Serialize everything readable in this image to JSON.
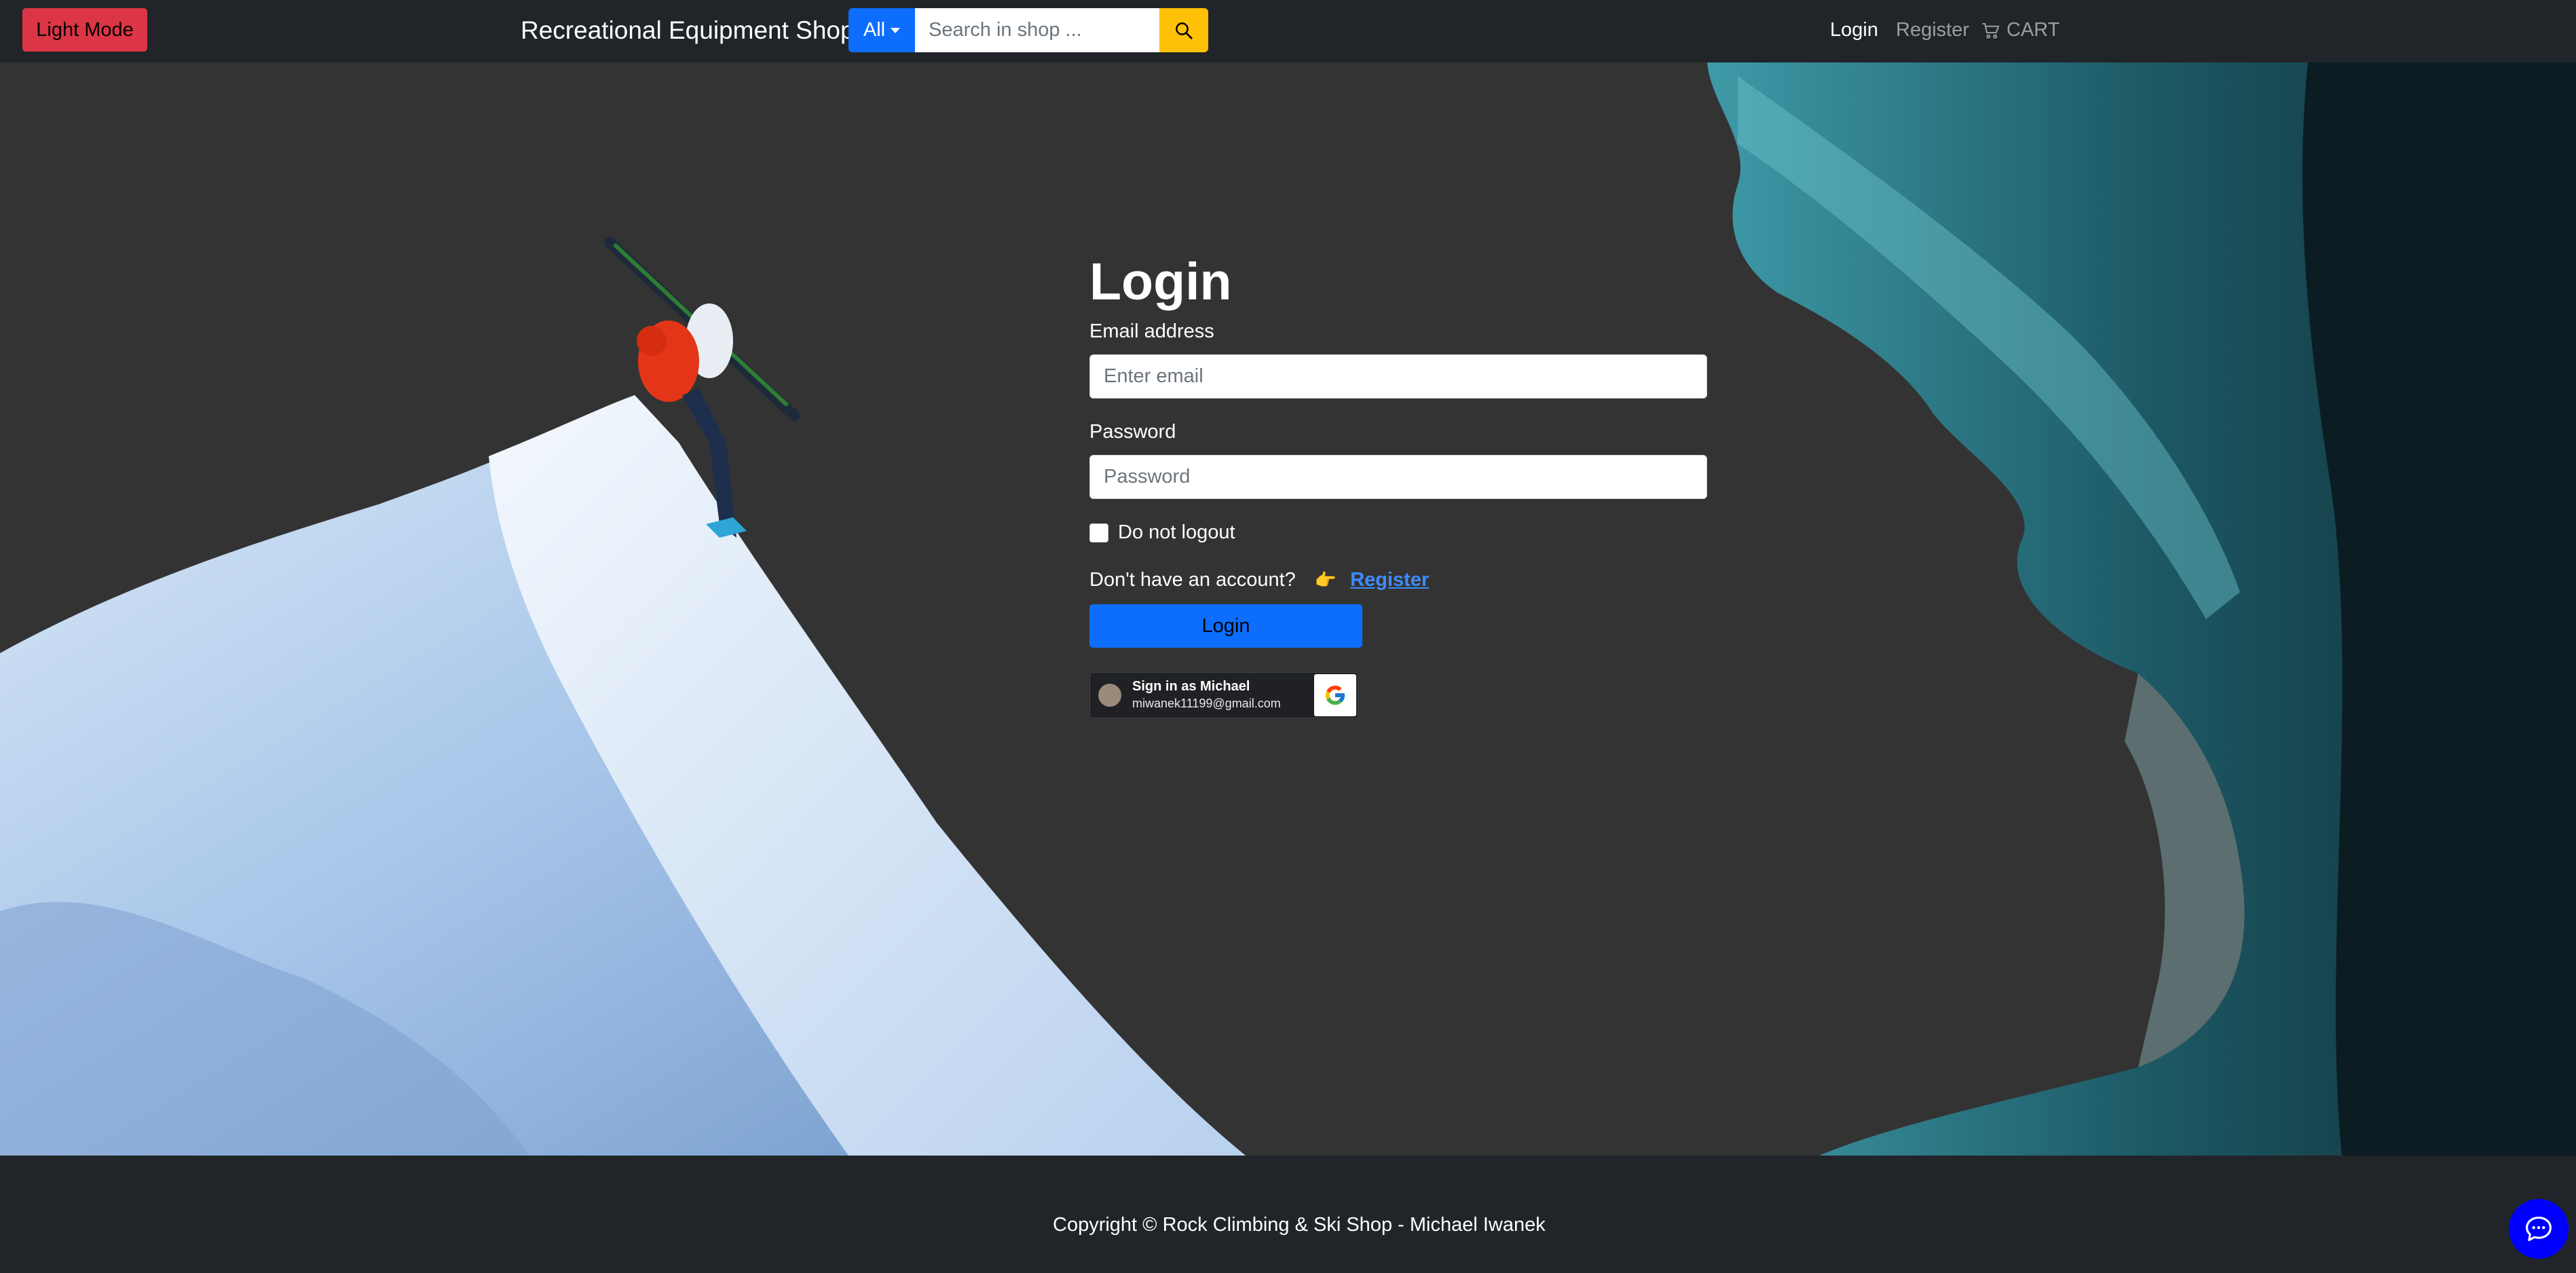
{
  "navbar": {
    "mode_toggle": "Light Mode",
    "brand": "Recreational Equipment Shop",
    "search": {
      "category": "All",
      "placeholder": "Search in shop ...",
      "value": ""
    },
    "links": {
      "login": "Login",
      "register": "Register",
      "cart": "CART"
    }
  },
  "login": {
    "title": "Login",
    "email_label": "Email address",
    "email_placeholder": "Enter email",
    "password_label": "Password",
    "password_placeholder": "Password",
    "remember_label": "Do not logout",
    "no_account_text": "Don't have an account?",
    "pointer": "👉",
    "register_link": "Register",
    "submit_label": "Login",
    "google": {
      "name_line": "Sign in as Michael",
      "email_line": "miwanek11199@gmail.com"
    }
  },
  "footer": {
    "copyright": "Copyright © Rock Climbing & Ski Shop - Michael Iwanek"
  },
  "colors": {
    "navbar_bg": "#212529",
    "page_bg": "#333333",
    "danger": "#dc3545",
    "primary": "#0d6efd",
    "warning": "#ffc107",
    "chat": "#0000ff"
  },
  "icons": [
    "search-icon",
    "cart-icon",
    "google-icon",
    "chat-icon",
    "pointing-hand-icon"
  ]
}
